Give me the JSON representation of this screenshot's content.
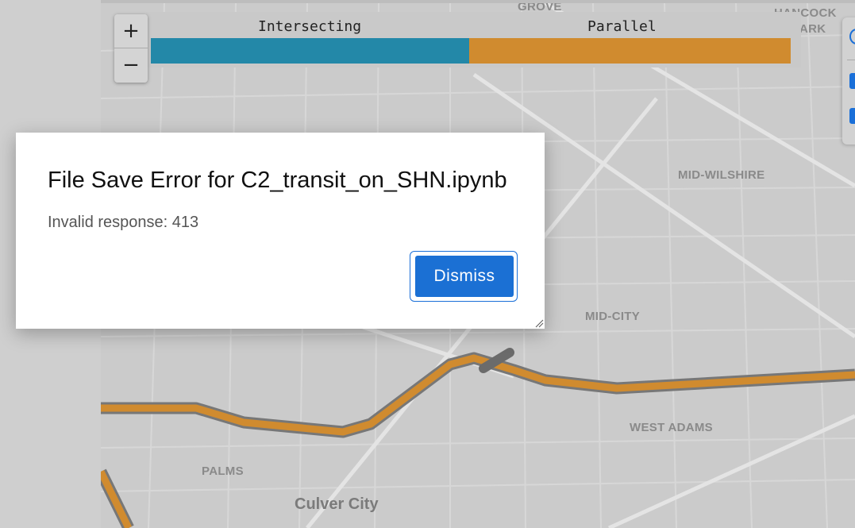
{
  "map": {
    "zoom_in_label": "+",
    "zoom_out_label": "−",
    "neighborhood_labels": {
      "grove": "GROVE",
      "hancock_line1": "HANCOCK",
      "hancock_line2": "ARK",
      "mid_wilshire": "MID-WILSHIRE",
      "mid_city": "MID-CITY",
      "west_adams": "WEST ADAMS",
      "palms": "PALMS",
      "culver_city": "Culver City"
    },
    "route_color": "#d08b2f"
  },
  "legend": {
    "categories": [
      {
        "label": "Intersecting",
        "color": "#2388a8",
        "share": 0.5
      },
      {
        "label": "Parallel",
        "color": "#d08b2f",
        "share": 0.5
      }
    ]
  },
  "dialog": {
    "title": "File Save Error for C2_transit_on_SHN.ipynb",
    "message": "Invalid response: 413",
    "dismiss_label": "Dismiss",
    "accent_color": "#1b70d4"
  }
}
